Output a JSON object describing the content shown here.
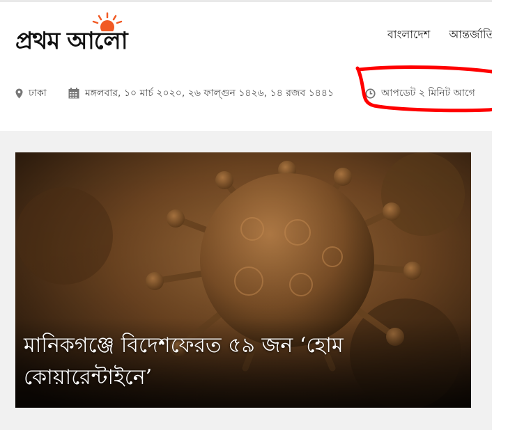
{
  "header": {
    "logo_text": "প্রথম আলো",
    "nav": [
      "বাংলাদেশ",
      "আন্তর্জাতি"
    ]
  },
  "info": {
    "location": "ঢাকা",
    "date": "মঙ্গলবার, ১০ মার্চ ২০২০, ২৬ ফাল্গুন ১৪২৬, ১৪ রজব ১৪৪১",
    "updated": "আপডেট ২ মিনিট আগে"
  },
  "hero": {
    "headline_line1": "মানিকগঞ্জে বিদেশফেরত ৫৯ জন ‘হোম",
    "headline_line2": "কোয়ারেন্টাইনে’"
  },
  "colors": {
    "logo_sun": "#f15a24",
    "annotation": "#ff0000",
    "image_tone": "#8a5a2c"
  },
  "icons": [
    "map-pin-icon",
    "calendar-icon",
    "clock-icon"
  ]
}
